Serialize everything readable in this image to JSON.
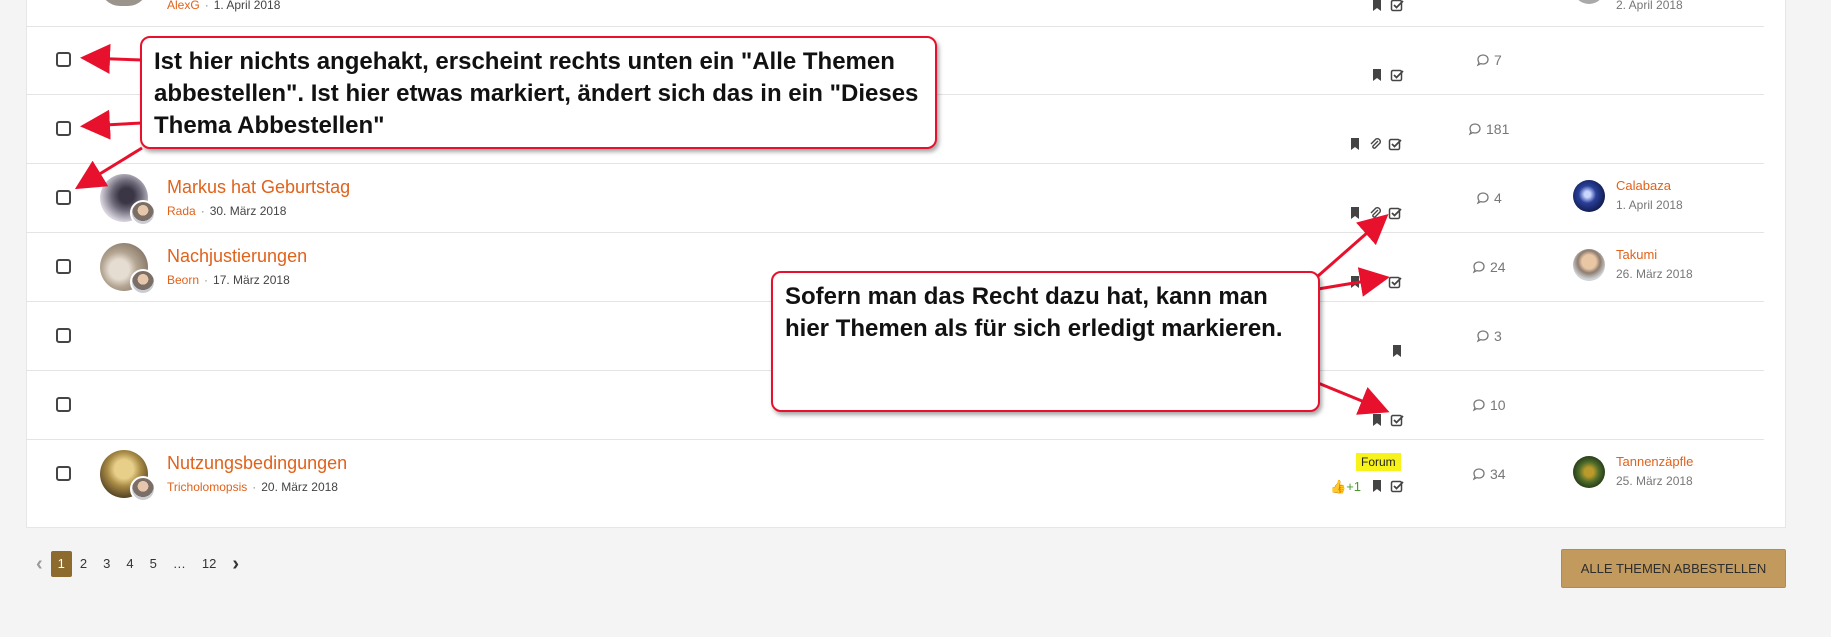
{
  "rows": [
    {
      "author": "AlexG",
      "date": "1. April 2018",
      "last_date": "2. April 2018"
    },
    {
      "replies": "7"
    },
    {
      "replies": "181"
    },
    {
      "title": "Markus hat Geburtstag",
      "author": "Rada",
      "date": "30. März 2018",
      "replies": "4",
      "last_name": "Calabaza",
      "last_date": "1. April 2018"
    },
    {
      "title": "Nachjustierungen",
      "author": "Beorn",
      "date": "17. März 2018",
      "replies": "24",
      "last_name": "Takumi",
      "last_date": "26. März 2018"
    },
    {
      "replies": "3"
    },
    {
      "replies": "10"
    },
    {
      "title": "Nutzungsbedingungen",
      "author": "Tricholomopsis",
      "date": "20. März 2018",
      "replies": "34",
      "last_name": "Tannenzäpfle",
      "last_date": "25. März 2018",
      "tag": "Forum",
      "likes": "+1"
    }
  ],
  "callouts": {
    "top": "Ist hier nichts angehakt, erscheint rechts unten ein \"Alle Themen abbestellen\". Ist hier etwas markiert, ändert sich das in ein \"Dieses Thema Abbestellen\"",
    "right": "Sofern man das Recht dazu hat, kann man hier Themen als für sich erledigt markieren."
  },
  "pagination": {
    "pages": [
      "1",
      "2",
      "3",
      "4",
      "5",
      "…",
      "12"
    ],
    "current": "1"
  },
  "unsubscribe_all_label": "ALLE THEMEN ABBESTELLEN",
  "colors": {
    "accent": "#e0621b",
    "button": "#c29a5e",
    "callout_border": "#e8112d",
    "page_active": "#8d6a2e"
  }
}
